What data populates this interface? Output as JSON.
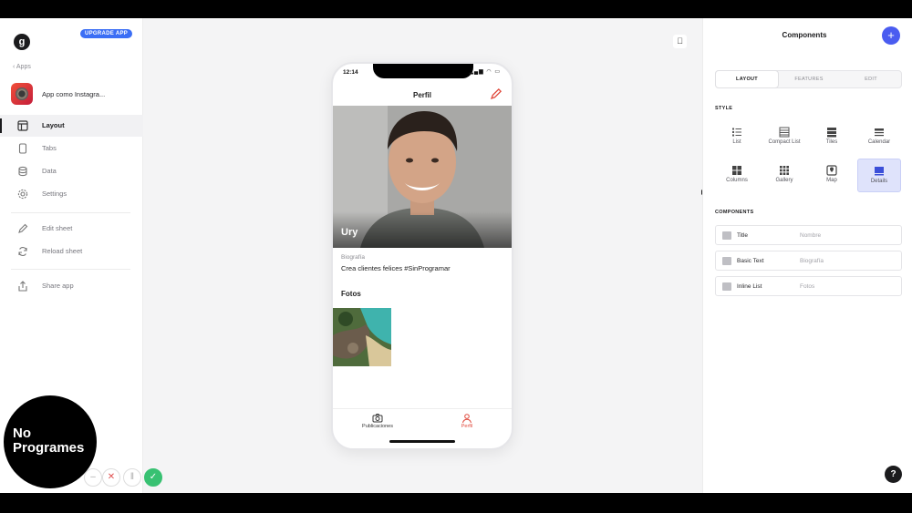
{
  "sidebar": {
    "logo_letter": "g",
    "upgrade_label": "UPGRADE APP",
    "back_label": "‹ Apps",
    "app_name": "App como Instagra...",
    "nav": [
      {
        "label": "Layout",
        "icon": "layout-icon",
        "active": true
      },
      {
        "label": "Tabs",
        "icon": "tablet-icon"
      },
      {
        "label": "Data",
        "icon": "database-icon"
      },
      {
        "label": "Settings",
        "icon": "gear-icon"
      }
    ],
    "actions": [
      {
        "label": "Edit sheet",
        "icon": "pencil-icon"
      },
      {
        "label": "Reload sheet",
        "icon": "reload-icon"
      }
    ],
    "share_label": "Share app"
  },
  "watermark": {
    "line1": "No",
    "line2": "Programes"
  },
  "phone": {
    "time": "12:14",
    "screen_title": "Perfil",
    "profile_name": "Ury",
    "bio_label": "Biografía",
    "bio_text": "Crea clientes felices #SinProgramar",
    "photos_heading": "Fotos",
    "tabs": [
      {
        "label": "Publicaciones",
        "icon": "camera-icon",
        "color": "#333333"
      },
      {
        "label": "Perfil",
        "icon": "person-icon",
        "color": "#e0493c"
      }
    ]
  },
  "panel": {
    "title": "Components",
    "segments": [
      "LAYOUT",
      "FEATURES",
      "EDIT"
    ],
    "style_heading": "STYLE",
    "styles": [
      "List",
      "Compact List",
      "Tiles",
      "Calendar",
      "Columns",
      "Gallery",
      "Map",
      "Details"
    ],
    "selected_style": "Details",
    "components_heading": "COMPONENTS",
    "components": [
      {
        "name": "Title",
        "value": "Nombre"
      },
      {
        "name": "Basic Text",
        "value": "Biografía"
      },
      {
        "name": "Inline List",
        "value": "Fotos"
      }
    ],
    "help_label": "?"
  },
  "colors": {
    "accent": "#4a5cf0",
    "upgrade": "#3b6ef5",
    "active_tab": "#e0493c",
    "confirm": "#38c172"
  }
}
